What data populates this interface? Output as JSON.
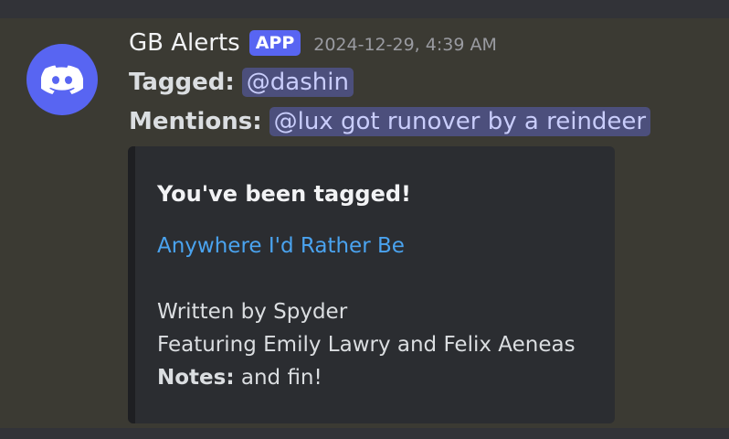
{
  "message": {
    "author": "GB Alerts",
    "badge": "APP",
    "timestamp": "2024-12-29, 4:39 AM",
    "avatar_icon": "discord-logo-icon",
    "tagged_label": "Tagged:",
    "tagged_mention": "@dashin",
    "mentions_label": "Mentions:",
    "mentions_value": "@lux got runover by a reindeer"
  },
  "embed": {
    "title": "You've been tagged!",
    "link_text": "Anywhere I'd Rather Be",
    "written_by": "Written by Spyder",
    "featuring": "Featuring Emily Lawry and Felix Aeneas",
    "notes_label": "Notes:",
    "notes_value": "and fin!"
  },
  "colors": {
    "brand": "#5865f2",
    "mention_bg": "#4c4f7c",
    "link": "#4aa3ef"
  }
}
